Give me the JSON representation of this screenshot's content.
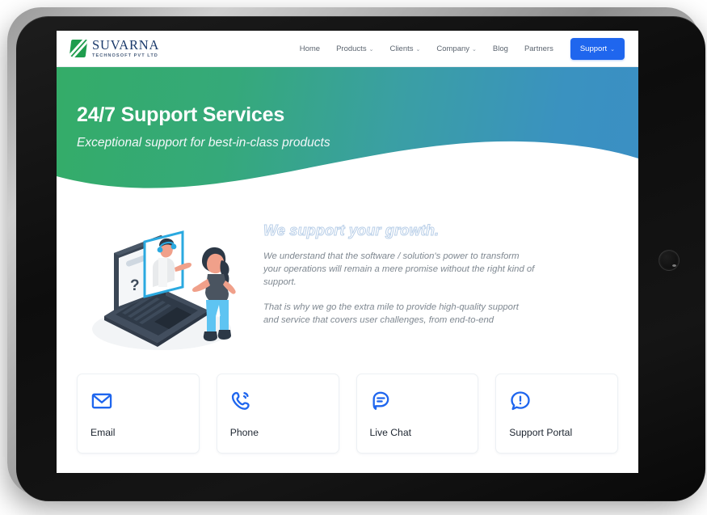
{
  "device": {
    "type": "tablet",
    "home_button": "home-button"
  },
  "site": {
    "brand": {
      "name": "SUVARNA",
      "tagline": "TECHNOSOFT PVT LTD",
      "logo_icon": "suvarna-logo-mark",
      "logo_color": "#1f9d4e",
      "name_color": "#1b3a6b"
    },
    "nav": {
      "items": [
        {
          "label": "Home",
          "has_dropdown": false
        },
        {
          "label": "Products",
          "has_dropdown": true,
          "caret": "⌄"
        },
        {
          "label": "Clients",
          "has_dropdown": true,
          "caret": "⌄"
        },
        {
          "label": "Company",
          "has_dropdown": true,
          "caret": "⌄"
        },
        {
          "label": "Blog",
          "has_dropdown": false
        },
        {
          "label": "Partners",
          "has_dropdown": false
        }
      ],
      "cta": {
        "label": "Support",
        "caret": "⌄",
        "color": "#1f66ee"
      }
    }
  },
  "hero": {
    "title": "24/7 Support Services",
    "subtitle": "Exceptional support for best-in-class products",
    "gradient_from": "#34ac68",
    "gradient_to": "#3b8fc4"
  },
  "main": {
    "illustration": "customer-support-video-call-illustration",
    "heading": "We support your growth.",
    "heading_stroke_color": "#b9cfe8",
    "paragraphs": [
      "We understand that the software / solution's power to transform your operations will remain a mere promise without the right kind of support.",
      "That is why we go the extra mile to provide high-quality support and service that covers user challenges, from end-to-end"
    ]
  },
  "cards": {
    "accent_color": "#1f66ee",
    "items": [
      {
        "label": "Email",
        "icon": "envelope-icon"
      },
      {
        "label": "Phone",
        "icon": "phone-call-icon"
      },
      {
        "label": "Live Chat",
        "icon": "chat-bubble-icon"
      },
      {
        "label": "Support Portal",
        "icon": "alert-bubble-icon"
      }
    ]
  }
}
